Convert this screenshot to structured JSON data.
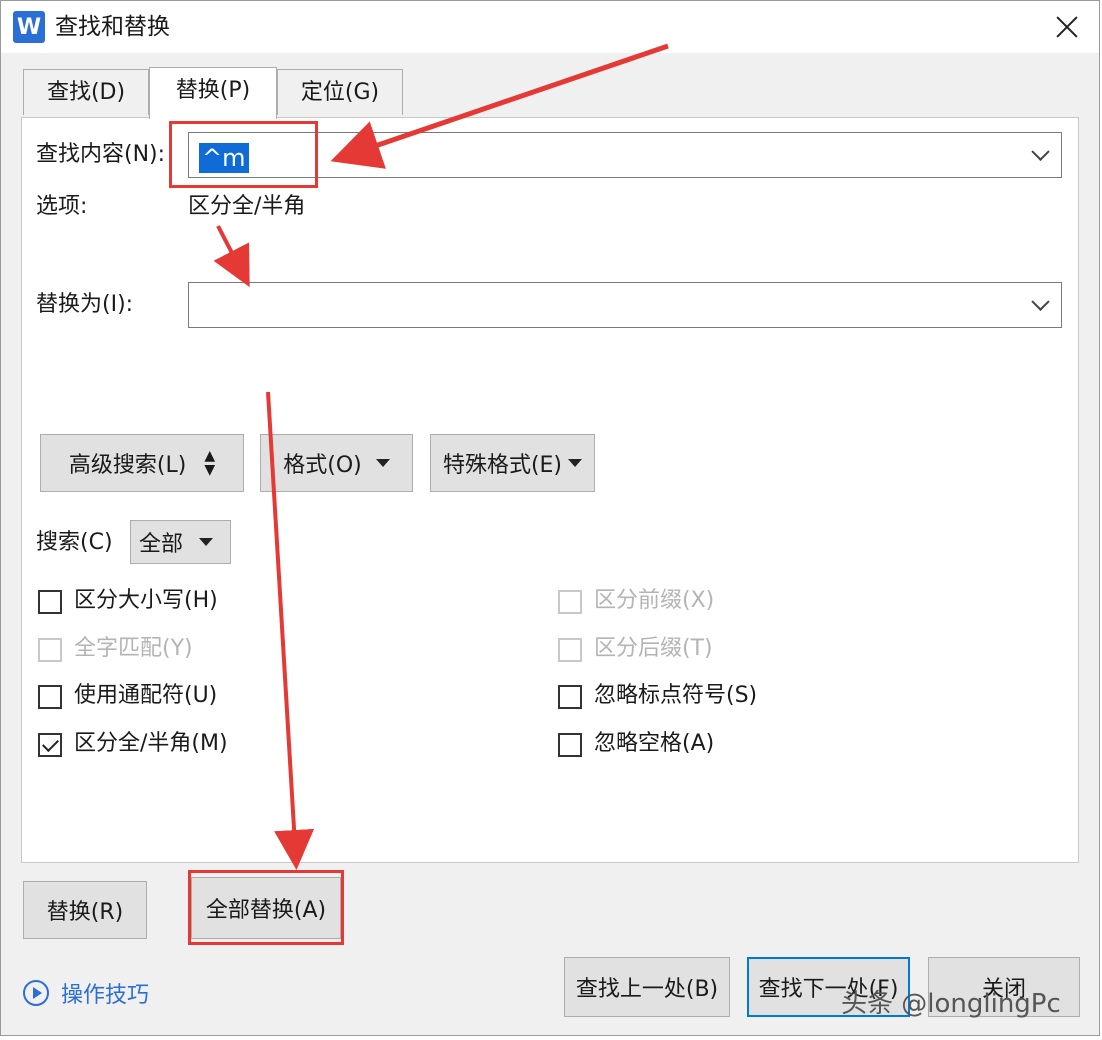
{
  "window": {
    "app_icon_glyph": "W",
    "title": "查找和替换"
  },
  "tabs": [
    {
      "label": "查找(D)",
      "active": false
    },
    {
      "label": "替换(P)",
      "active": true
    },
    {
      "label": "定位(G)",
      "active": false
    }
  ],
  "find": {
    "label": "查找内容(N):",
    "value": "^m"
  },
  "options": {
    "label": "选项:",
    "value": "区分全/半角"
  },
  "replace": {
    "label": "替换为(I):",
    "value": ""
  },
  "buttons": {
    "advanced_search": "高级搜索(L)",
    "format": "格式(O)",
    "special_format": "特殊格式(E)",
    "replace": "替换(R)",
    "replace_all": "全部替换(A)",
    "find_prev": "查找上一处(B)",
    "find_next": "查找下一处(F)",
    "close": "关闭"
  },
  "search": {
    "label": "搜索(C)",
    "value": "全部"
  },
  "checkboxes": {
    "match_case": {
      "label": "区分大小写(H)",
      "checked": false,
      "enabled": true
    },
    "whole_word": {
      "label": "全字匹配(Y)",
      "checked": false,
      "enabled": false
    },
    "wildcards": {
      "label": "使用通配符(U)",
      "checked": false,
      "enabled": true
    },
    "full_half_width": {
      "label": "区分全/半角(M)",
      "checked": true,
      "enabled": true
    },
    "match_prefix": {
      "label": "区分前缀(X)",
      "checked": false,
      "enabled": false
    },
    "match_suffix": {
      "label": "区分后缀(T)",
      "checked": false,
      "enabled": false
    },
    "ignore_punct": {
      "label": "忽略标点符号(S)",
      "checked": false,
      "enabled": true
    },
    "ignore_space": {
      "label": "忽略空格(A)",
      "checked": false,
      "enabled": true
    }
  },
  "tips": {
    "label": "操作技巧"
  },
  "watermark": "头条 @longlingPc",
  "colors": {
    "annotation_red": "#e53935",
    "accent_blue": "#2b6fd6",
    "selection_blue": "#0f6bd6"
  }
}
